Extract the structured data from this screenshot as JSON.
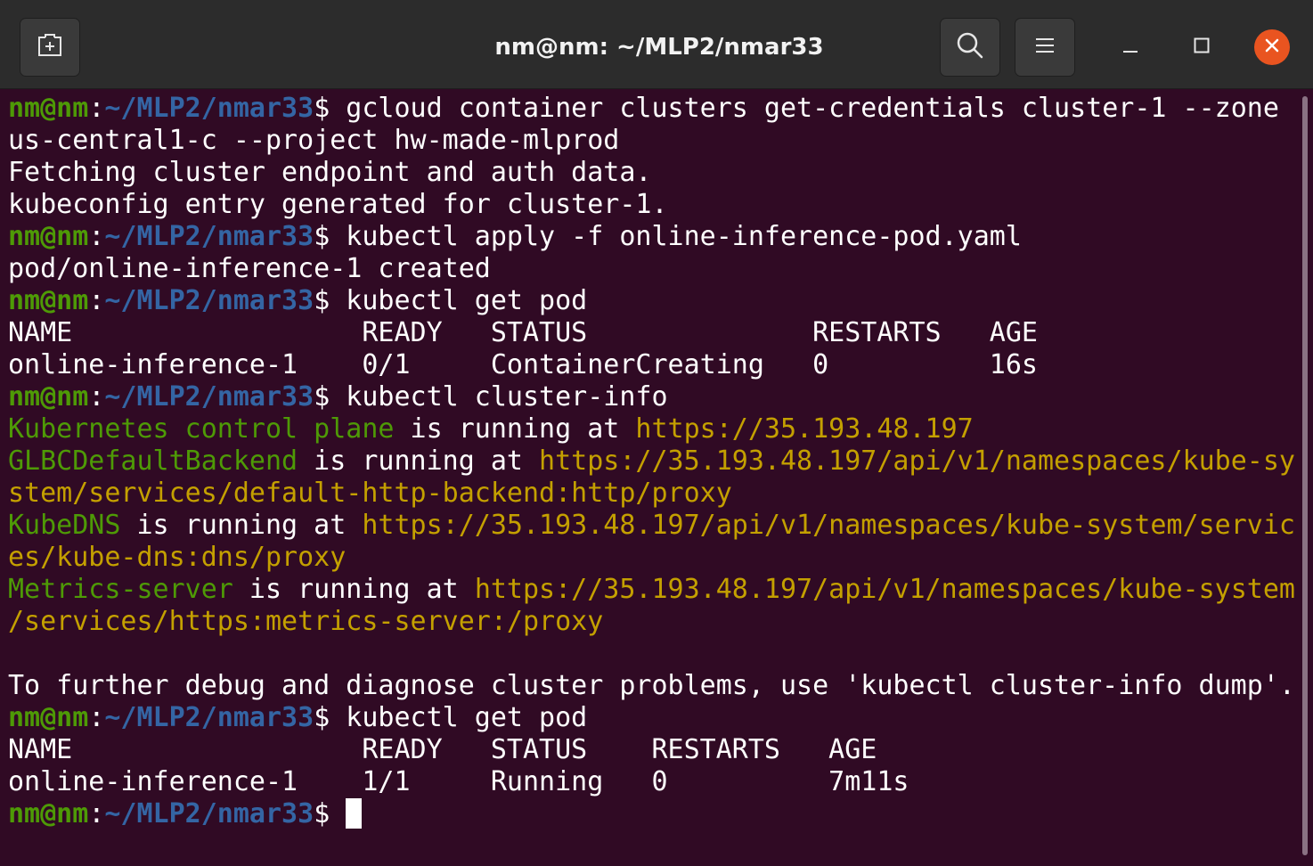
{
  "window": {
    "title": "nm@nm: ~/MLP2/nmar33"
  },
  "titlebar_buttons": {
    "new_tab": "new-tab-icon",
    "search": "search-icon",
    "menu": "hamburger-menu-icon",
    "minimize": "minimize-icon",
    "maximize": "maximize-icon",
    "close": "close-icon"
  },
  "colors": {
    "terminal_background": "#300a24",
    "prompt_user": "#4e9a06",
    "prompt_path": "#3465a4",
    "url": "#c4a000",
    "service_name": "#4e9a06",
    "close_button": "#e95420"
  },
  "prompt": {
    "user_host": "nm@nm",
    "colon": ":",
    "path": "~/MLP2/nmar33",
    "symbol": "$"
  },
  "lines": [
    {
      "type": "prompt",
      "command": " gcloud container clusters get-credentials cluster-1 --zone"
    },
    {
      "type": "text",
      "text": "us-central1-c --project hw-made-mlprod"
    },
    {
      "type": "text",
      "text": "Fetching cluster endpoint and auth data."
    },
    {
      "type": "text",
      "text": "kubeconfig entry generated for cluster-1."
    },
    {
      "type": "prompt",
      "command": " kubectl apply -f online-inference-pod.yaml"
    },
    {
      "type": "text",
      "text": "pod/online-inference-1 created"
    },
    {
      "type": "prompt",
      "command": " kubectl get pod"
    },
    {
      "type": "text",
      "text": "NAME                  READY   STATUS              RESTARTS   AGE"
    },
    {
      "type": "text",
      "text": "online-inference-1    0/1     ContainerCreating   0          16s"
    },
    {
      "type": "prompt",
      "command": " kubectl cluster-info"
    },
    {
      "type": "info",
      "name": "Kubernetes control plane",
      "mid": " is running at ",
      "url": "https://35.193.48.197"
    },
    {
      "type": "info",
      "name": "GLBCDefaultBackend",
      "mid": " is running at ",
      "url": "https://35.193.48.197/api/v1/namespaces/kube-sy"
    },
    {
      "type": "url",
      "text": "stem/services/default-http-backend:http/proxy"
    },
    {
      "type": "info",
      "name": "KubeDNS",
      "mid": " is running at ",
      "url": "https://35.193.48.197/api/v1/namespaces/kube-system/servic"
    },
    {
      "type": "url",
      "text": "es/kube-dns:dns/proxy"
    },
    {
      "type": "info",
      "name": "Metrics-server",
      "mid": " is running at ",
      "url": "https://35.193.48.197/api/v1/namespaces/kube-system"
    },
    {
      "type": "url",
      "text": "/services/https:metrics-server:/proxy"
    },
    {
      "type": "text",
      "text": ""
    },
    {
      "type": "text",
      "text": "To further debug and diagnose cluster problems, use 'kubectl cluster-info dump'."
    },
    {
      "type": "prompt",
      "command": " kubectl get pod"
    },
    {
      "type": "text",
      "text": "NAME                  READY   STATUS    RESTARTS   AGE"
    },
    {
      "type": "text",
      "text": "online-inference-1    1/1     Running   0          7m11s"
    },
    {
      "type": "prompt",
      "command": " ",
      "cursor": true
    }
  ]
}
